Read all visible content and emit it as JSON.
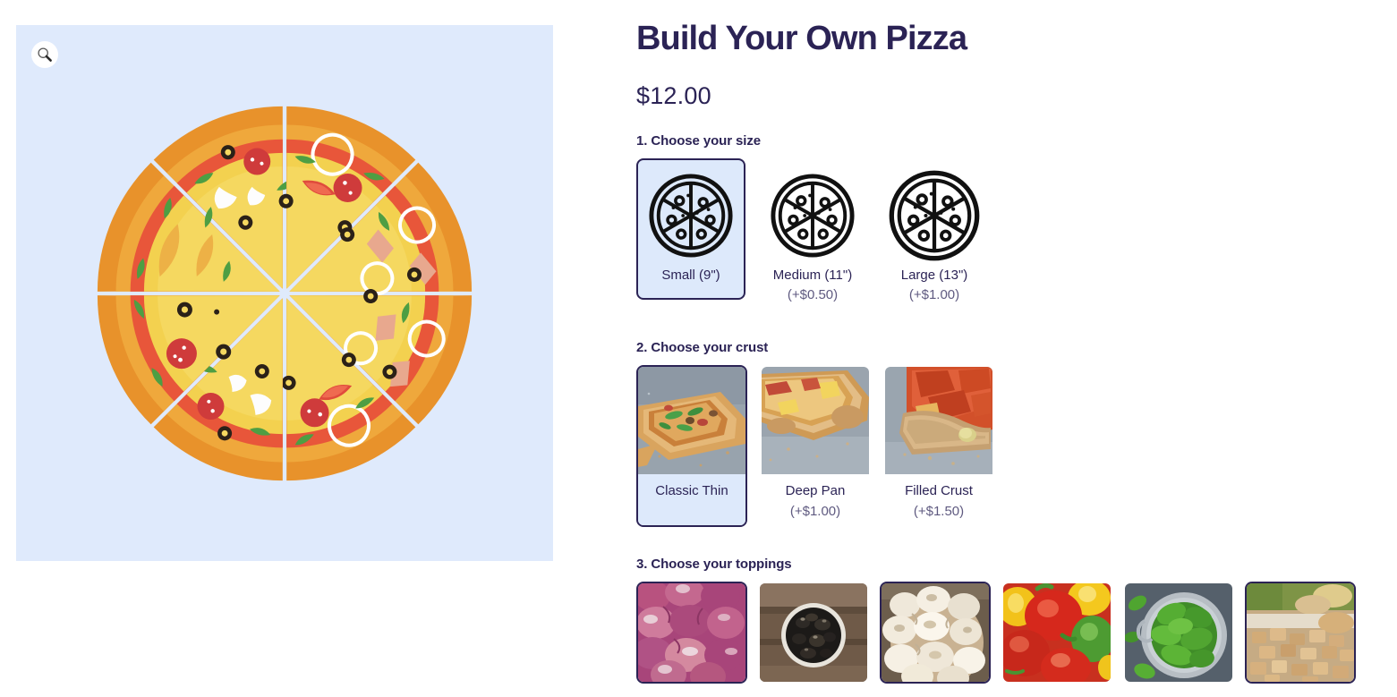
{
  "product": {
    "title": "Build Your Own Pizza",
    "price": "$12.00"
  },
  "image_panel": {
    "zoom_icon": "magnifier-icon",
    "artwork": "sliced-pizza-illustration",
    "background_color": "#dfeafc"
  },
  "steps": {
    "size_heading": "1. Choose your size",
    "crust_heading": "2. Choose your crust",
    "toppings_heading": "3. Choose your toppings"
  },
  "sizes": [
    {
      "label": "Small (9\")",
      "price": "",
      "selected": true,
      "icon": "pizza-slices-icon"
    },
    {
      "label": "Medium (11\")",
      "price": "(+$0.50)",
      "selected": false,
      "icon": "pizza-slices-icon"
    },
    {
      "label": "Large (13\")",
      "price": "(+$1.00)",
      "selected": false,
      "icon": "pizza-slices-icon"
    }
  ],
  "crusts": [
    {
      "label": "Classic Thin",
      "price": "",
      "selected": true,
      "image": "thin-crust-pizza-photo"
    },
    {
      "label": "Deep Pan",
      "price": "(+$1.00)",
      "selected": false,
      "image": "deep-pan-pizza-photo"
    },
    {
      "label": "Filled Crust",
      "price": "(+$1.50)",
      "selected": false,
      "image": "filled-crust-pizza-photo"
    }
  ],
  "toppings": [
    {
      "name": "red-onions",
      "selected": true
    },
    {
      "name": "black-olives",
      "selected": false
    },
    {
      "name": "mushrooms",
      "selected": true
    },
    {
      "name": "bell-peppers",
      "selected": false
    },
    {
      "name": "spinach",
      "selected": false
    },
    {
      "name": "chicken",
      "selected": true
    }
  ],
  "colors": {
    "brand_navy": "#2b2355",
    "selected_fill": "#dde9fb",
    "panel_blue": "#dfeafc",
    "muted_text": "#5f5a80"
  }
}
